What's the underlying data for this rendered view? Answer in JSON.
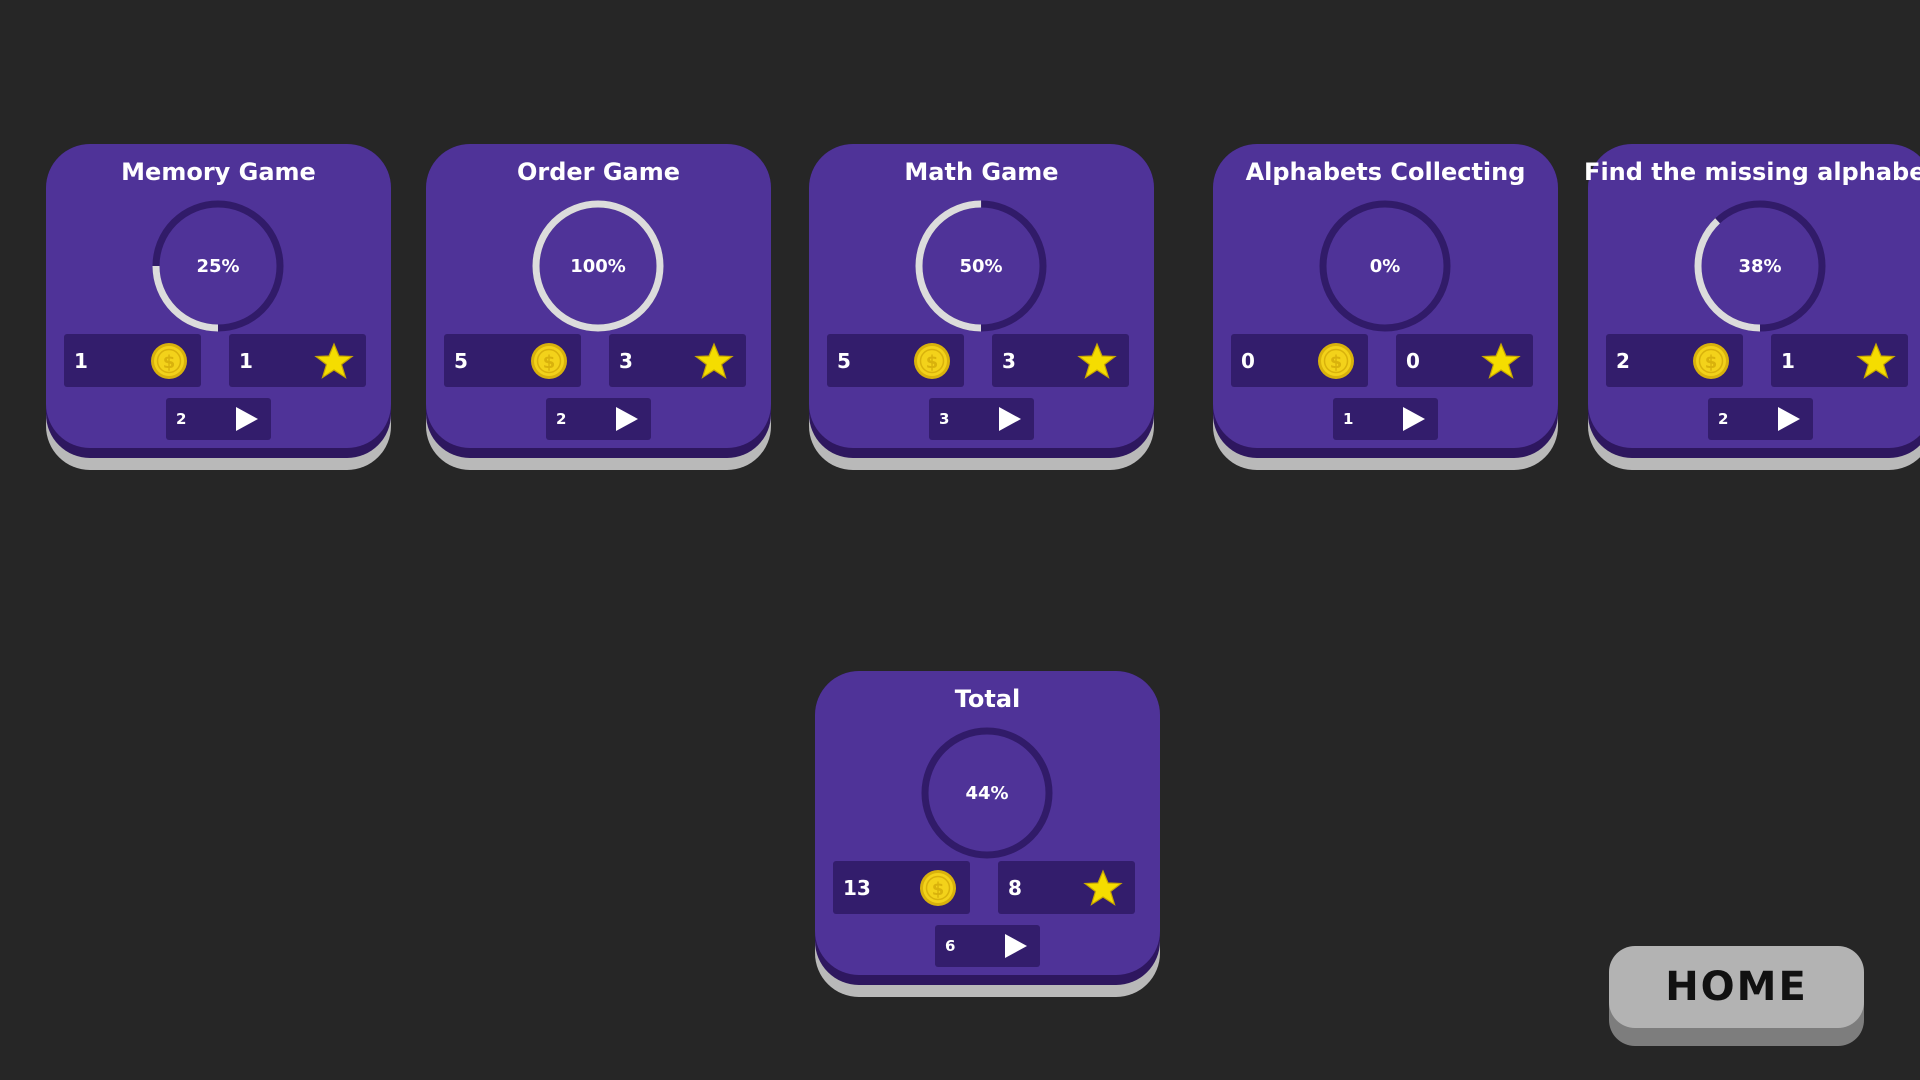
{
  "colors": {
    "background": "#262626",
    "card_face": "#4f3398",
    "card_rim": "#2e175f",
    "stat_box": "#331d6c",
    "ring_track": "#311b69",
    "ring_progress": "#dcdcdc",
    "coin": "#f3d21a",
    "star": "#f5dd00"
  },
  "icons": {
    "coin": "dollar-coin-icon",
    "star": "star-icon",
    "play": "play-icon"
  },
  "cards": [
    {
      "title": "Memory Game",
      "progress_label": "25%",
      "progress": 0.25,
      "coins": "1",
      "stars": "1",
      "plays": "2"
    },
    {
      "title": "Order Game",
      "progress_label": "100%",
      "progress": 1.0,
      "coins": "5",
      "stars": "3",
      "plays": "2"
    },
    {
      "title": "Math Game",
      "progress_label": "50%",
      "progress": 0.5,
      "coins": "5",
      "stars": "3",
      "plays": "3"
    },
    {
      "title": "Alphabets Collecting",
      "progress_label": "0%",
      "progress": 0.0,
      "coins": "0",
      "stars": "0",
      "plays": "1"
    },
    {
      "title": "Find the missing alphabet",
      "progress_label": "38%",
      "progress": 0.38,
      "coins": "2",
      "stars": "1",
      "plays": "2"
    }
  ],
  "total": {
    "title": "Total",
    "progress_label": "44%",
    "progress": 0.0,
    "coins": "13",
    "stars": "8",
    "plays": "6"
  },
  "home_button": {
    "label": "HOME"
  }
}
